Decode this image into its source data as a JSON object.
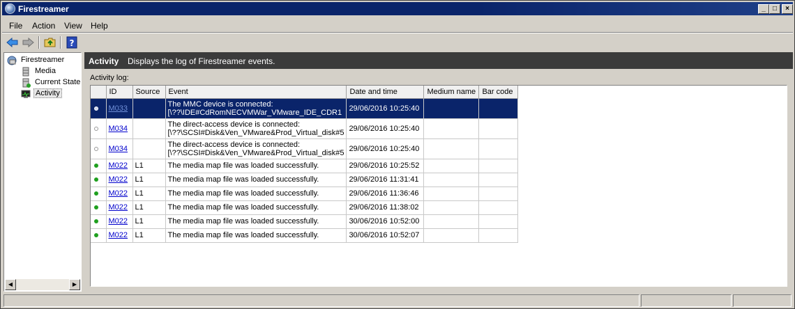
{
  "window": {
    "title": "Firestreamer"
  },
  "menu": {
    "items": [
      "File",
      "Action",
      "View",
      "Help"
    ]
  },
  "toolbar": {
    "icons": [
      "back-arrow-icon",
      "forward-arrow-icon",
      "up-folder-icon",
      "help-book-icon"
    ]
  },
  "tree": {
    "root": "Firestreamer",
    "children": [
      "Media",
      "Current State",
      "Activity"
    ],
    "selected": "Activity"
  },
  "panel": {
    "title": "Activity",
    "description": "Displays the log of Firestreamer events."
  },
  "activity_log": {
    "label": "Activity log:",
    "columns": [
      "",
      "ID",
      "Source",
      "Event",
      "Date and time",
      "Medium name",
      "Bar code"
    ],
    "rows": [
      {
        "status": "info",
        "id": "M033",
        "source": "",
        "event1": "The MMC device is connected:",
        "event2": "[\\??\\IDE#CdRomNECVMWar_VMware_IDE_CDR1",
        "datetime": "29/06/2016 10:25:40",
        "medium": "",
        "barcode": "",
        "selected": true
      },
      {
        "status": "info",
        "id": "M034",
        "source": "",
        "event1": "The direct-access device is connected:",
        "event2": "[\\??\\SCSI#Disk&Ven_VMware&Prod_Virtual_disk#5",
        "datetime": "29/06/2016 10:25:40",
        "medium": "",
        "barcode": ""
      },
      {
        "status": "info",
        "id": "M034",
        "source": "",
        "event1": "The direct-access device is connected:",
        "event2": "[\\??\\SCSI#Disk&Ven_VMware&Prod_Virtual_disk#5",
        "datetime": "29/06/2016 10:25:40",
        "medium": "",
        "barcode": ""
      },
      {
        "status": "ok",
        "id": "M022",
        "source": "L1",
        "event1": "The media map file was loaded successfully.",
        "datetime": "29/06/2016 10:25:52",
        "medium": "",
        "barcode": ""
      },
      {
        "status": "ok",
        "id": "M022",
        "source": "L1",
        "event1": "The media map file was loaded successfully.",
        "datetime": "29/06/2016 11:31:41",
        "medium": "",
        "barcode": ""
      },
      {
        "status": "ok",
        "id": "M022",
        "source": "L1",
        "event1": "The media map file was loaded successfully.",
        "datetime": "29/06/2016 11:36:46",
        "medium": "",
        "barcode": ""
      },
      {
        "status": "ok",
        "id": "M022",
        "source": "L1",
        "event1": "The media map file was loaded successfully.",
        "datetime": "29/06/2016 11:38:02",
        "medium": "",
        "barcode": ""
      },
      {
        "status": "ok",
        "id": "M022",
        "source": "L1",
        "event1": "The media map file was loaded successfully.",
        "datetime": "30/06/2016 10:52:00",
        "medium": "",
        "barcode": ""
      },
      {
        "status": "ok",
        "id": "M022",
        "source": "L1",
        "event1": "The media map file was loaded successfully.",
        "datetime": "30/06/2016 10:52:07",
        "medium": "",
        "barcode": ""
      }
    ]
  },
  "colors": {
    "titlebar": "#0a246a",
    "selection": "#0a246a",
    "panel_header": "#3b3b3b",
    "ok_status": "#1fa01f",
    "link": "#0000cc"
  }
}
